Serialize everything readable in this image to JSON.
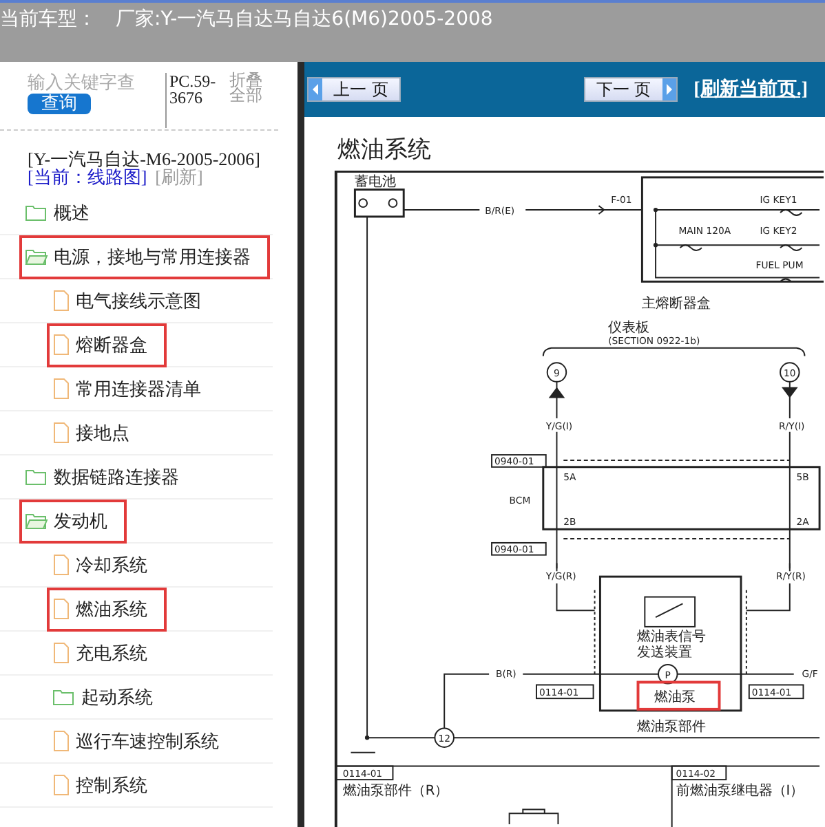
{
  "title_bar": {
    "label": "当前车型：",
    "maker": "厂家:Y-一汽马自达马自达6(M6)2005-2008"
  },
  "sidebar": {
    "search": {
      "placeholder": "输入关键字查"
    },
    "search_button": "查询",
    "code": "PC.59-3676",
    "collapse_all": "折叠全部",
    "model": "[Y-一汽马自达-M6-2005-2006]",
    "current": "[当前：线路图]",
    "refresh": "[刷新]",
    "tree": [
      {
        "label": "概述",
        "kind": "folder",
        "expanded": false,
        "highlighted": false
      },
      {
        "label": "电源，接地与常用连接器",
        "kind": "folder",
        "expanded": true,
        "highlighted": true,
        "children": [
          {
            "label": "电气接线示意图",
            "kind": "page",
            "highlighted": false
          },
          {
            "label": "熔断器盒",
            "kind": "page",
            "highlighted": true
          },
          {
            "label": "常用连接器清单",
            "kind": "page",
            "highlighted": false
          },
          {
            "label": "接地点",
            "kind": "page",
            "highlighted": false
          }
        ]
      },
      {
        "label": "数据链路连接器",
        "kind": "folder",
        "expanded": false,
        "highlighted": false
      },
      {
        "label": "发动机",
        "kind": "folder",
        "expanded": true,
        "highlighted": true,
        "children": [
          {
            "label": "冷却系统",
            "kind": "page",
            "highlighted": false
          },
          {
            "label": "燃油系统",
            "kind": "page",
            "highlighted": true
          },
          {
            "label": "充电系统",
            "kind": "page",
            "highlighted": false
          },
          {
            "label": "起动系统",
            "kind": "folder",
            "highlighted": false
          },
          {
            "label": "巡行车速控制系统",
            "kind": "page",
            "highlighted": false
          },
          {
            "label": "控制系统",
            "kind": "page",
            "highlighted": false
          }
        ]
      }
    ]
  },
  "toolbar": {
    "prev": "上一 页",
    "next": "下一 页",
    "refresh": "[刷新当前页.]"
  },
  "page": {
    "title": "燃油系统",
    "diagram": {
      "labels": [
        "蓄电池",
        "B/R(E)",
        "F-01",
        "IG KEY1",
        "MAIN 120A",
        "IG KEY2",
        "FUEL PUM",
        "主熔断器盒",
        "仪表板",
        "(SECTION 0922-1b)",
        "9",
        "10",
        "Y/G(I)",
        "R/Y(I)",
        "0940-01",
        "5A",
        "5B",
        "BCM",
        "2B",
        "2A",
        "0940-01",
        "Y/G(R)",
        "R/Y(R)",
        "燃油表信号",
        "发送装置",
        "B(R)",
        "P",
        "G/F",
        "0114-01",
        "0114-01",
        "燃油泵部件",
        "12",
        "0114-01",
        "燃油泵部件（R）",
        "0114-02",
        "前燃油泵继电器（I）"
      ],
      "pump_label": {
        "text": "燃油泵",
        "highlighted": true
      }
    }
  }
}
